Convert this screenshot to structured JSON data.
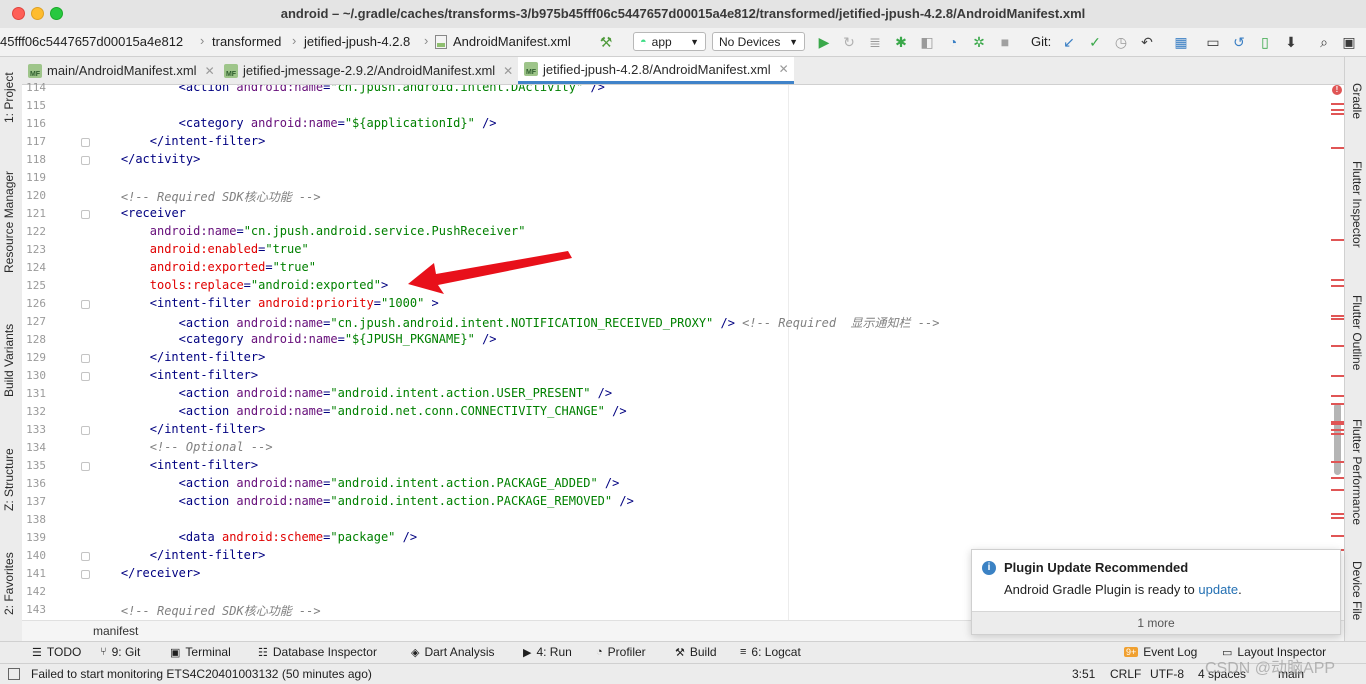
{
  "window": {
    "title": "android – ~/.gradle/caches/transforms-3/b975b45fff06c5447657d00015a4e812/transformed/jetified-jpush-4.2.8/AndroidManifest.xml"
  },
  "breadcrumb": [
    "45fff06c5447657d00015a4e812",
    "transformed",
    "jetified-jpush-4.2.8",
    "AndroidManifest.xml"
  ],
  "toolbar": {
    "run_config": "app",
    "device": "No Devices",
    "git_label": "Git:"
  },
  "tabs": [
    {
      "label": "main/AndroidManifest.xml",
      "active": false
    },
    {
      "label": "jetified-jmessage-2.9.2/AndroidManifest.xml",
      "active": false
    },
    {
      "label": "jetified-jpush-4.2.8/AndroidManifest.xml",
      "active": true
    }
  ],
  "left_tools": [
    "1: Project",
    "Resource Manager",
    "Build Variants",
    "Z: Structure",
    "2: Favorites"
  ],
  "right_tools": [
    "Gradle",
    "Flutter Inspector",
    "Flutter Outline",
    "Flutter Performance",
    "Device File"
  ],
  "editor": {
    "lines": [
      {
        "n": "114",
        "indent": 6,
        "parts": [
          [
            "tag",
            "<action "
          ],
          [
            "an",
            "android:"
          ],
          [
            "an",
            "name"
          ],
          [
            "tag",
            "="
          ],
          [
            "val",
            "\"cn.jpush.android.intent.DActivity\""
          ],
          [
            "tag",
            " />"
          ]
        ]
      },
      {
        "n": "115",
        "indent": 0,
        "parts": []
      },
      {
        "n": "116",
        "indent": 6,
        "parts": [
          [
            "tag",
            "<category "
          ],
          [
            "an",
            "android:"
          ],
          [
            "an",
            "name"
          ],
          [
            "tag",
            "="
          ],
          [
            "val",
            "\"${applicationId}\""
          ],
          [
            "tag",
            " />"
          ]
        ]
      },
      {
        "n": "117",
        "indent": 4,
        "parts": [
          [
            "tag",
            "</intent-filter>"
          ]
        ]
      },
      {
        "n": "118",
        "indent": 2,
        "parts": [
          [
            "tag",
            "</activity>"
          ]
        ]
      },
      {
        "n": "119",
        "indent": 0,
        "parts": []
      },
      {
        "n": "120",
        "indent": 2,
        "parts": [
          [
            "cm",
            "<!-- Required SDK核心功能 -->"
          ]
        ]
      },
      {
        "n": "121",
        "indent": 2,
        "parts": [
          [
            "tag",
            "<receiver"
          ]
        ]
      },
      {
        "n": "122",
        "indent": 4,
        "parts": [
          [
            "an",
            "android:name"
          ],
          [
            "tag",
            "="
          ],
          [
            "val",
            "\"cn.jpush.android.service.PushReceiver\""
          ]
        ]
      },
      {
        "n": "123",
        "indent": 4,
        "parts": [
          [
            "ar",
            "android:enabled"
          ],
          [
            "tag",
            "="
          ],
          [
            "val",
            "\"true\""
          ]
        ]
      },
      {
        "n": "124",
        "indent": 4,
        "parts": [
          [
            "ar",
            "android:exported"
          ],
          [
            "tag",
            "="
          ],
          [
            "val",
            "\"true\""
          ]
        ]
      },
      {
        "n": "125",
        "indent": 4,
        "parts": [
          [
            "ar",
            "tools:replace"
          ],
          [
            "tag",
            "="
          ],
          [
            "val",
            "\"android:exported\""
          ],
          [
            "tag",
            ">"
          ]
        ]
      },
      {
        "n": "126",
        "indent": 4,
        "parts": [
          [
            "tag",
            "<intent-filter "
          ],
          [
            "ar",
            "android:priority"
          ],
          [
            "tag",
            "="
          ],
          [
            "val",
            "\"1000\""
          ],
          [
            "tag",
            " >"
          ]
        ]
      },
      {
        "n": "127",
        "indent": 6,
        "parts": [
          [
            "tag",
            "<action "
          ],
          [
            "an",
            "android:name"
          ],
          [
            "tag",
            "="
          ],
          [
            "val",
            "\"cn.jpush.android.intent.NOTIFICATION_RECEIVED_PROXY\""
          ],
          [
            "tag",
            " /> "
          ],
          [
            "cm",
            "<!-- Required  显示通知栏 -->"
          ]
        ]
      },
      {
        "n": "128",
        "indent": 6,
        "parts": [
          [
            "tag",
            "<category "
          ],
          [
            "an",
            "android:name"
          ],
          [
            "tag",
            "="
          ],
          [
            "val",
            "\"${JPUSH_PKGNAME}\""
          ],
          [
            "tag",
            " />"
          ]
        ]
      },
      {
        "n": "129",
        "indent": 4,
        "parts": [
          [
            "tag",
            "</intent-filter>"
          ]
        ]
      },
      {
        "n": "130",
        "indent": 4,
        "parts": [
          [
            "tag",
            "<intent-filter>"
          ]
        ]
      },
      {
        "n": "131",
        "indent": 6,
        "parts": [
          [
            "tag",
            "<action "
          ],
          [
            "an",
            "android:name"
          ],
          [
            "tag",
            "="
          ],
          [
            "val",
            "\"android.intent.action.USER_PRESENT\""
          ],
          [
            "tag",
            " />"
          ]
        ]
      },
      {
        "n": "132",
        "indent": 6,
        "parts": [
          [
            "tag",
            "<action "
          ],
          [
            "an",
            "android:name"
          ],
          [
            "tag",
            "="
          ],
          [
            "val",
            "\"android.net.conn.CONNECTIVITY_CHANGE\""
          ],
          [
            "tag",
            " />"
          ]
        ]
      },
      {
        "n": "133",
        "indent": 4,
        "parts": [
          [
            "tag",
            "</intent-filter>"
          ]
        ]
      },
      {
        "n": "134",
        "indent": 4,
        "parts": [
          [
            "cm",
            "<!-- Optional -->"
          ]
        ]
      },
      {
        "n": "135",
        "indent": 4,
        "parts": [
          [
            "tag",
            "<intent-filter>"
          ]
        ]
      },
      {
        "n": "136",
        "indent": 6,
        "parts": [
          [
            "tag",
            "<action "
          ],
          [
            "an",
            "android:name"
          ],
          [
            "tag",
            "="
          ],
          [
            "val",
            "\"android.intent.action.PACKAGE_ADDED\""
          ],
          [
            "tag",
            " />"
          ]
        ]
      },
      {
        "n": "137",
        "indent": 6,
        "parts": [
          [
            "tag",
            "<action "
          ],
          [
            "an",
            "android:name"
          ],
          [
            "tag",
            "="
          ],
          [
            "val",
            "\"android.intent.action.PACKAGE_REMOVED\""
          ],
          [
            "tag",
            " />"
          ]
        ]
      },
      {
        "n": "138",
        "indent": 0,
        "parts": []
      },
      {
        "n": "139",
        "indent": 6,
        "parts": [
          [
            "tag",
            "<data "
          ],
          [
            "ar",
            "android:scheme"
          ],
          [
            "tag",
            "="
          ],
          [
            "val",
            "\"package\""
          ],
          [
            "tag",
            " />"
          ]
        ]
      },
      {
        "n": "140",
        "indent": 4,
        "parts": [
          [
            "tag",
            "</intent-filter>"
          ]
        ]
      },
      {
        "n": "141",
        "indent": 2,
        "parts": [
          [
            "tag",
            "</receiver>"
          ]
        ]
      },
      {
        "n": "142",
        "indent": 0,
        "parts": []
      },
      {
        "n": "143",
        "indent": 2,
        "parts": [
          [
            "cm",
            "<!-- Required SDK核心功能 -->"
          ]
        ]
      }
    ],
    "footer_crumb": "manifest"
  },
  "tool_windows": [
    {
      "icon": "☰",
      "label": "TODO"
    },
    {
      "icon": "⑂",
      "label": "9: Git"
    },
    {
      "icon": "▣",
      "label": "Terminal"
    },
    {
      "icon": "☷",
      "label": "Database Inspector"
    },
    {
      "icon": "◈",
      "label": "Dart Analysis"
    },
    {
      "icon": "▶",
      "label": "4: Run"
    },
    {
      "icon": "◔",
      "label": "Profiler"
    },
    {
      "icon": "⚒",
      "label": "Build"
    },
    {
      "icon": "≡",
      "label": "6: Logcat"
    }
  ],
  "tool_windows_right": [
    {
      "icon": "9+",
      "label": "Event Log"
    },
    {
      "icon": "▭",
      "label": "Layout Inspector"
    }
  ],
  "status": {
    "message": "Failed to start monitoring ETS4C20401003132 (50 minutes ago)",
    "position": "3:51",
    "line_sep": "CRLF",
    "encoding": "UTF-8",
    "indent": "4 spaces",
    "branch": "main"
  },
  "notification": {
    "title": "Plugin Update Recommended",
    "body_prefix": "Android Gradle Plugin is ready to ",
    "link": "update",
    "body_suffix": ".",
    "more": "1 more"
  },
  "watermark": "CSDN @动脑APP",
  "colors": {
    "accent": "#4083c9",
    "arrow": "#e8101a"
  }
}
